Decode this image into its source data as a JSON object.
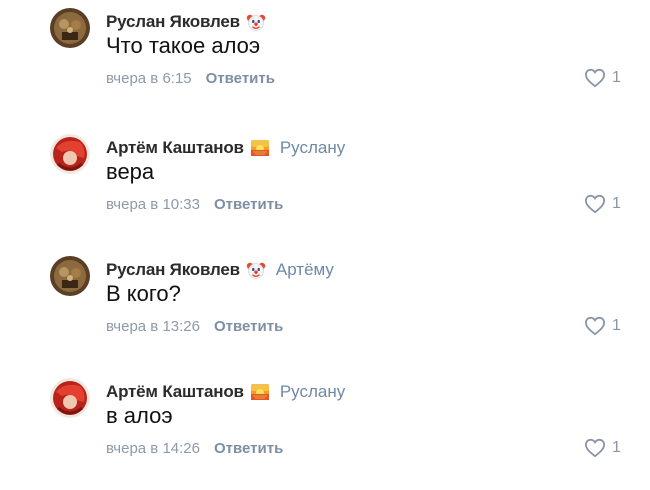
{
  "colors": {
    "author": "#2b2b2b",
    "reply_to": "#6f88a6",
    "meta": "#8c9aab",
    "like_icon": "#8a96a8"
  },
  "comments": [
    {
      "author": "Руслан Яковлев",
      "badge_icon": "clown-face-emoji-icon",
      "reply_to": "",
      "text": "Что такое алоэ",
      "time": "вчера в 6:15",
      "reply_label": "Ответить",
      "likes": "1"
    },
    {
      "author": "Артём Каштанов",
      "badge_icon": "sunset-emoji-icon",
      "reply_to": "Руслану",
      "text": "вера",
      "time": "вчера в 10:33",
      "reply_label": "Ответить",
      "likes": "1"
    },
    {
      "author": "Руслан Яковлев",
      "badge_icon": "clown-face-emoji-icon",
      "reply_to": "Артёму",
      "text": "В кого?",
      "time": "вчера в 13:26",
      "reply_label": "Ответить",
      "likes": "1"
    },
    {
      "author": "Артём Каштанов",
      "badge_icon": "sunset-emoji-icon",
      "reply_to": "Руслану",
      "text": "в алоэ",
      "time": "вчера в 14:26",
      "reply_label": "Ответить",
      "likes": "1"
    }
  ]
}
